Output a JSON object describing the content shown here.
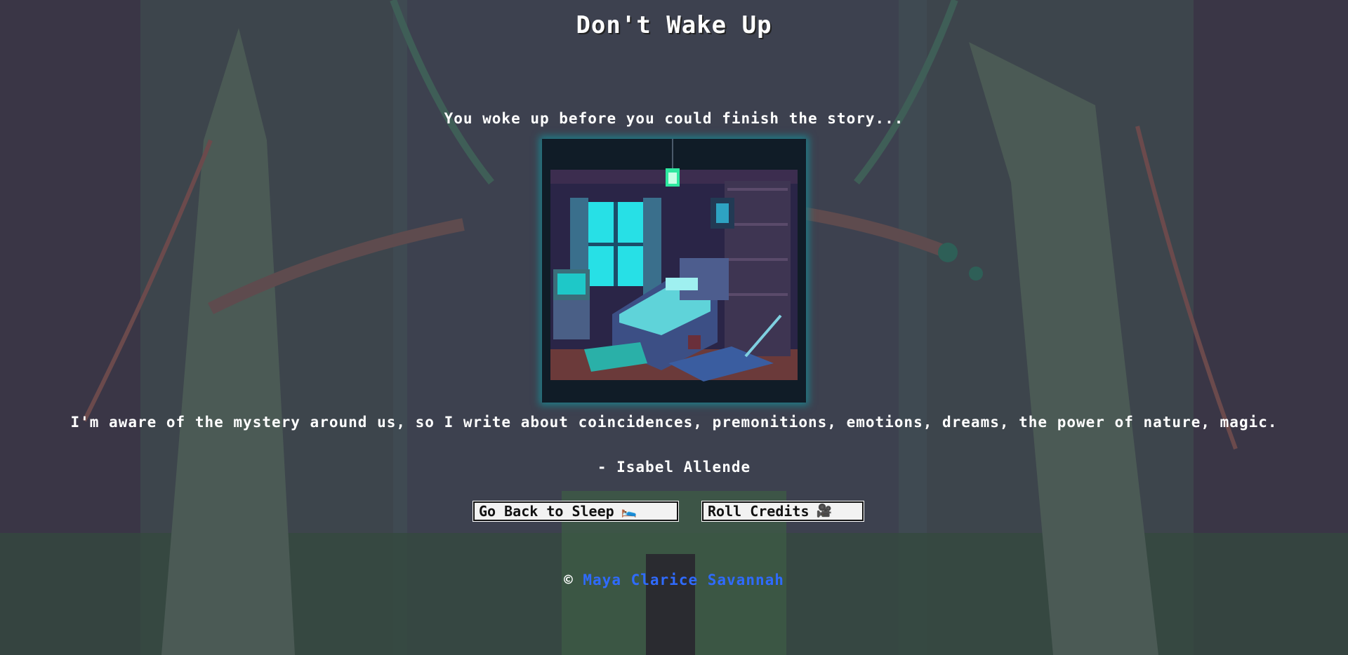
{
  "page": {
    "title": "Don't Wake Up",
    "subtitle": "You woke up before you could finish the story...",
    "quote": "I'm aware of the mystery around us, so I write about coincidences, premonitions, emotions, dreams, the power of nature, magic.",
    "author": "- Isabel Allende"
  },
  "buttons": {
    "sleep_label": "Go Back to Sleep",
    "sleep_icon": "🛌",
    "credits_label": "Roll Credits",
    "credits_icon": "🎥"
  },
  "footer": {
    "copyright_symbol": "©",
    "author_link": "Maya Clarice Savannah"
  },
  "colors": {
    "background": "#3a3646",
    "link": "#2f6bff",
    "frame_glow": "#1f7b86"
  }
}
